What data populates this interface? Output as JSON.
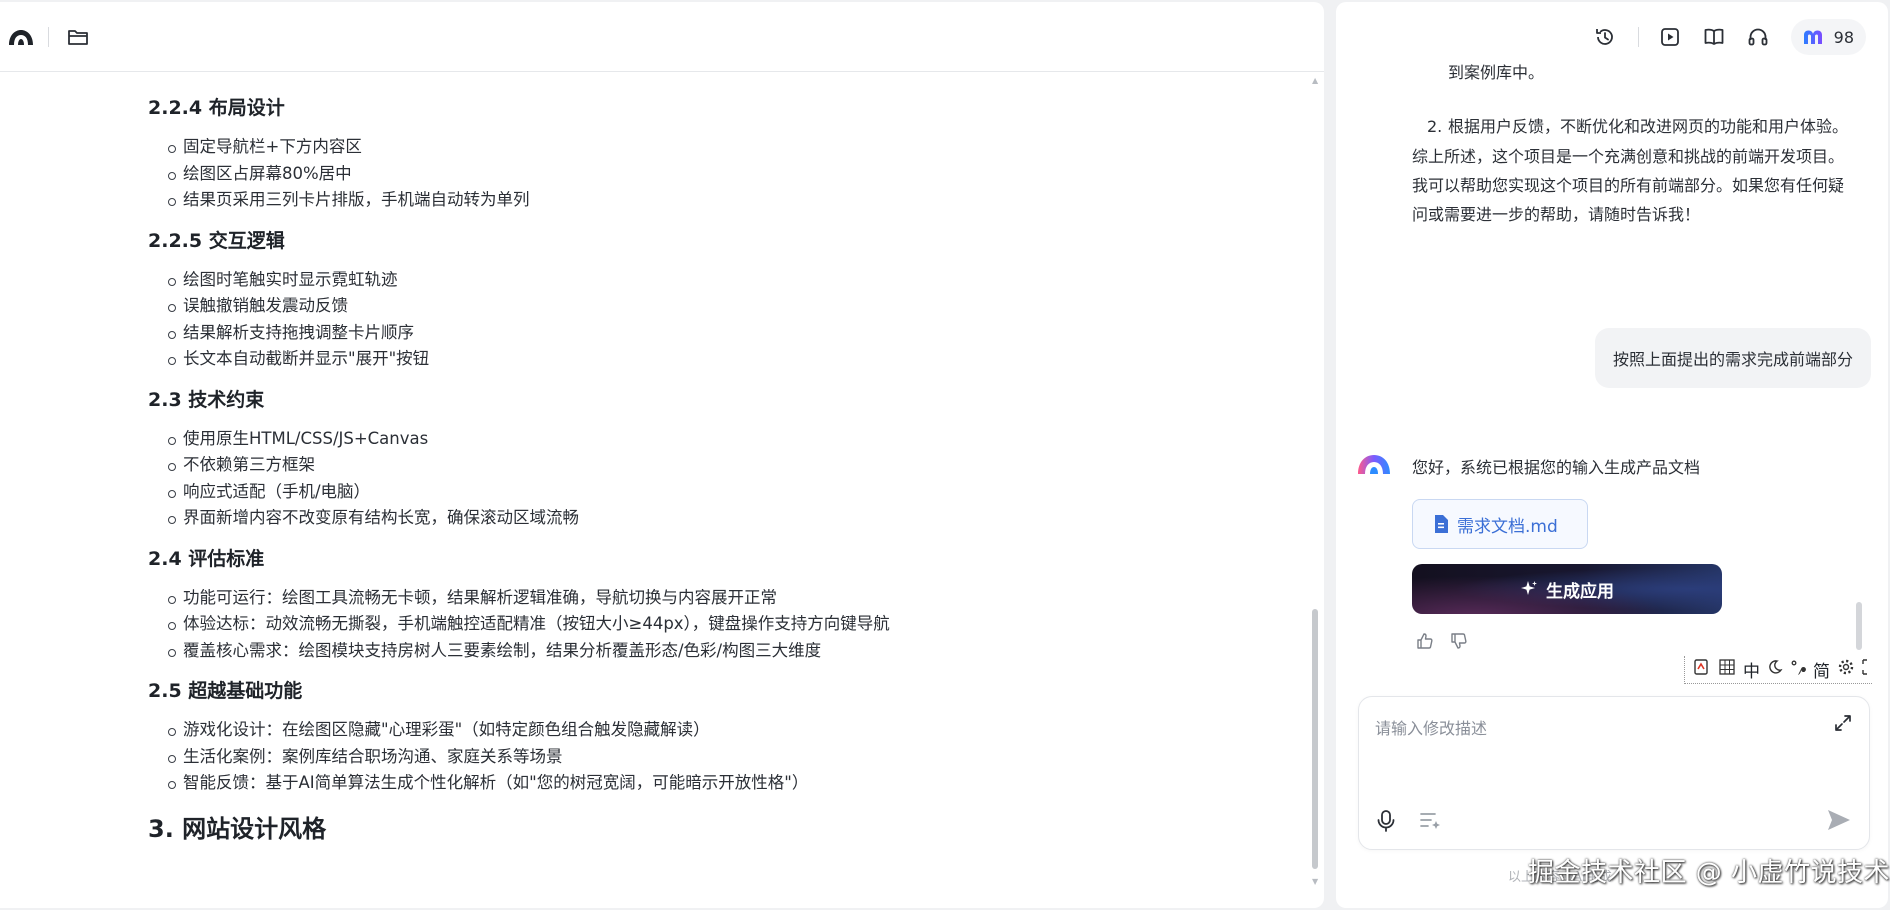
{
  "header_left": {
    "logo_icon": "app-logo-icon",
    "folder_icon": "folder-icon"
  },
  "document": {
    "sections": [
      {
        "heading": "2.2.4 布局设计",
        "items": [
          "固定导航栏+下方内容区",
          "绘图区占屏幕80%居中",
          "结果页采用三列卡片排版，手机端自动转为单列"
        ]
      },
      {
        "heading": "2.2.5 交互逻辑",
        "items": [
          "绘图时笔触实时显示霓虹轨迹",
          "误触撤销触发震动反馈",
          "结果解析支持拖拽调整卡片顺序",
          "长文本自动截断并显示\"展开\"按钮"
        ]
      },
      {
        "heading": "2.3 技术约束",
        "items": [
          "使用原生HTML/CSS/JS+Canvas",
          "不依赖第三方框架",
          "响应式适配（手机/电脑）",
          "界面新增内容不改变原有结构长宽，确保滚动区域流畅"
        ]
      },
      {
        "heading": "2.4 评估标准",
        "items": [
          "功能可运行：绘图工具流畅无卡顿，结果解析逻辑准确，导航切换与内容展开正常",
          "体验达标：动效流畅无撕裂，手机端触控适配精准（按钮大小≥44px），键盘操作支持方向键导航",
          "覆盖核心需求：绘图模块支持房树人三要素绘制，结果分析覆盖形态/色彩/构图三大维度"
        ]
      },
      {
        "heading": "2.5 超越基础功能",
        "items": [
          "游戏化设计：在绘图区隐藏\"心理彩蛋\"（如特定颜色组合触发隐藏解读）",
          "生活化案例：案例库结合职场沟通、家庭关系等场景",
          "智能反馈：基于AI简单算法生成个性化解析（如\"您的树冠宽阔，可能暗示开放性格\"）"
        ]
      }
    ],
    "next_heading": "3. 网站设计风格"
  },
  "toolbar_right": {
    "icons": [
      "history-icon",
      "play-icon",
      "book-icon",
      "headphones-icon"
    ],
    "credits_value": "98"
  },
  "chat": {
    "partial_top_text": "到案例库中。",
    "list_item_number": "2.",
    "list_item_text": "根据用户反馈，不断优化和改进网页的功能和用户体验。",
    "summary_text": "综上所述，这个项目是一个充满创意和挑战的前端开发项目。我可以帮助您实现这个项目的所有前端部分。如果您有任何疑问或需要进一步的帮助，请随时告诉我！",
    "user_message": "按照上面提出的需求完成前端部分",
    "bot_greeting": "您好，系统已根据您的输入生成产品文档",
    "file_name": "需求文档.md",
    "generate_button": "生成应用"
  },
  "ime_bar": {
    "items": [
      "中",
      "简"
    ]
  },
  "input": {
    "placeholder": "请输入修改描述"
  },
  "watermark": {
    "text": "掘金技术社区 @ 小虚竹说技术",
    "small_text": "以上内容由AI生成"
  }
}
